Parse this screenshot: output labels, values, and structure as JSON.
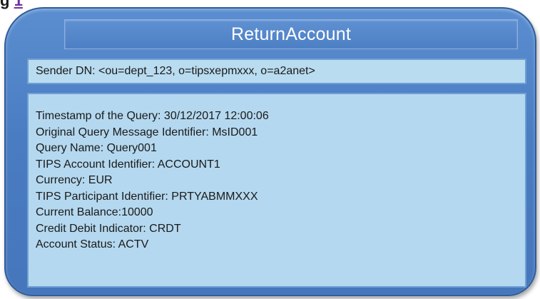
{
  "heading_fragment": {
    "text": "g",
    "footnote": "1"
  },
  "message": {
    "title": "ReturnAccount",
    "sender_dn": "Sender DN: <ou=dept_123, o=tipsxepmxxx, o=a2anet>",
    "fields": [
      "Timestamp of the Query: 30/12/2017 12:00:06",
      "Original Query Message Identifier: MsID001",
      "Query Name: Query001",
      "TIPS Account Identifier: ACCOUNT1",
      "Currency: EUR",
      "TIPS Participant Identifier: PRTYABMMXXX",
      "Current Balance:10000",
      "Credit Debit Indicator: CRDT",
      "Account Status: ACTV"
    ]
  },
  "colors": {
    "card_blue": "#4a7cc2",
    "panel_light_blue": "#b4d8ef",
    "title_text": "#ffffff"
  }
}
